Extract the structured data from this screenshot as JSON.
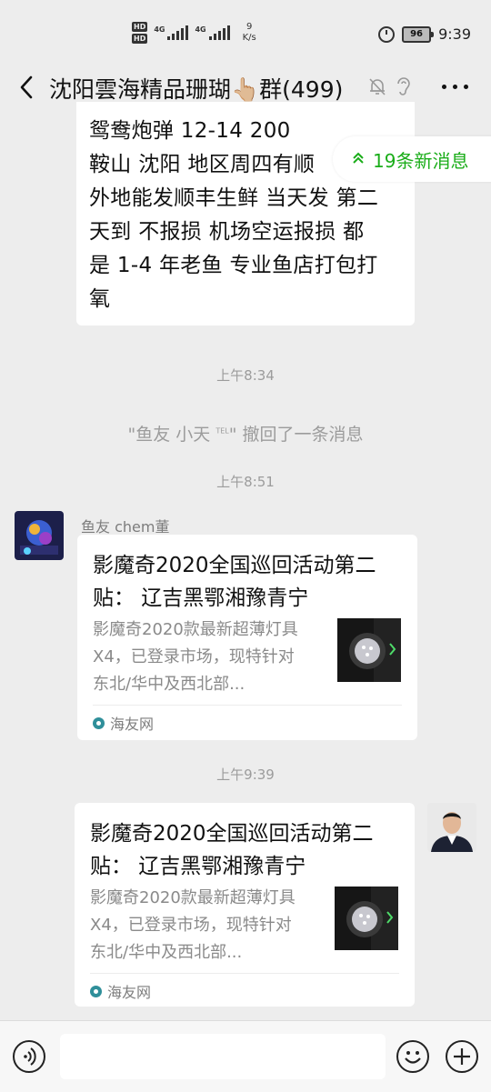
{
  "status_bar": {
    "hd_label": "HD",
    "signal_label_1": "4G",
    "signal_label_2": "4G",
    "net_speed_value": "9",
    "net_speed_unit": "K/s",
    "battery": "96",
    "time": "9:39"
  },
  "header": {
    "title": "沈阳雲海精品珊瑚👆🏼群(499)",
    "icons": [
      "back-icon",
      "mute-icon",
      "ear-icon",
      "more-icon"
    ]
  },
  "new_messages_pill": {
    "label": "19条新消息"
  },
  "messages": {
    "first_bubble": {
      "lines": [
        "鸳鸯炮弹 12-14   200",
        "鞍山  沈阳  地区周四有顺",
        "外地能发顺丰生鲜  当天发  第二",
        "天到  不报损  机场空运报损  都",
        "是 1-4 年老鱼  专业鱼店打包打",
        "氧"
      ]
    },
    "time_1": "上午8:34",
    "recall_notice": {
      "prefix": "\"鱼友 小天 ",
      "sup": "TEL",
      "suffix": "\" 撤回了一条消息"
    },
    "time_2": "上午8:51",
    "incoming_card": {
      "sender": "鱼友 chem董",
      "title": "影魔奇2020全国巡回活动第二贴：  辽吉黑鄂湘豫青宁",
      "description": "影魔奇2020款最新超薄灯具X4，已登录市场，现特针对东北/华中及西北部...",
      "source": "海友网"
    },
    "time_3": "上午9:39",
    "outgoing_card": {
      "title": "影魔奇2020全国巡回活动第二贴：  辽吉黑鄂湘豫青宁",
      "description": "影魔奇2020款最新超薄灯具X4，已登录市场，现特针对东北/华中及西北部...",
      "source": "海友网"
    }
  },
  "input_bar": {
    "placeholder": "",
    "icons": [
      "voice-icon",
      "emoji-icon",
      "plus-icon"
    ]
  },
  "colors": {
    "background": "#ededed",
    "accent_green": "#1aad19",
    "bubble": "#ffffff"
  }
}
